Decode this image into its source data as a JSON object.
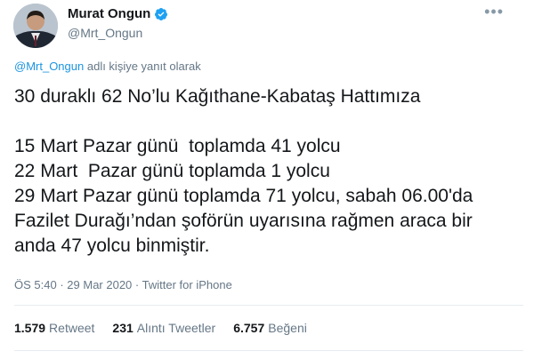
{
  "author": {
    "name": "Murat Ongun",
    "handle": "@Mrt_Ongun"
  },
  "reply": {
    "mention": "@Mrt_Ongun",
    "suffix": "adlı kişiye yanıt olarak"
  },
  "tweet": {
    "lines": [
      "30 duraklı 62 No’lu Kağıthane-Kabataş Hattımıza",
      "",
      "15 Mart Pazar günü  toplamda 41 yolcu",
      "22 Mart  Pazar günü toplamda 1 yolcu",
      "29 Mart Pazar günü toplamda 71 yolcu, sabah 06.00'da",
      "Fazilet Durağı’ndan şoförün uyarısına rağmen araca bir",
      "anda 47 yolcu binmiştir."
    ]
  },
  "meta": {
    "time": "ÖS 5:40",
    "date": "29 Mar 2020",
    "source": "Twitter for iPhone",
    "sep": "·"
  },
  "stats": {
    "retweets_count": "1.579",
    "retweets_label": "Retweet",
    "quotes_count": "231",
    "quotes_label": "Alıntı Tweetler",
    "likes_count": "6.757",
    "likes_label": "Beğeni"
  },
  "colors": {
    "link": "#1b95e0",
    "verified": "#1da1f2",
    "secondary": "#657786"
  },
  "icons": {
    "verified": "verified-badge-icon",
    "more": "more-options-icon"
  }
}
